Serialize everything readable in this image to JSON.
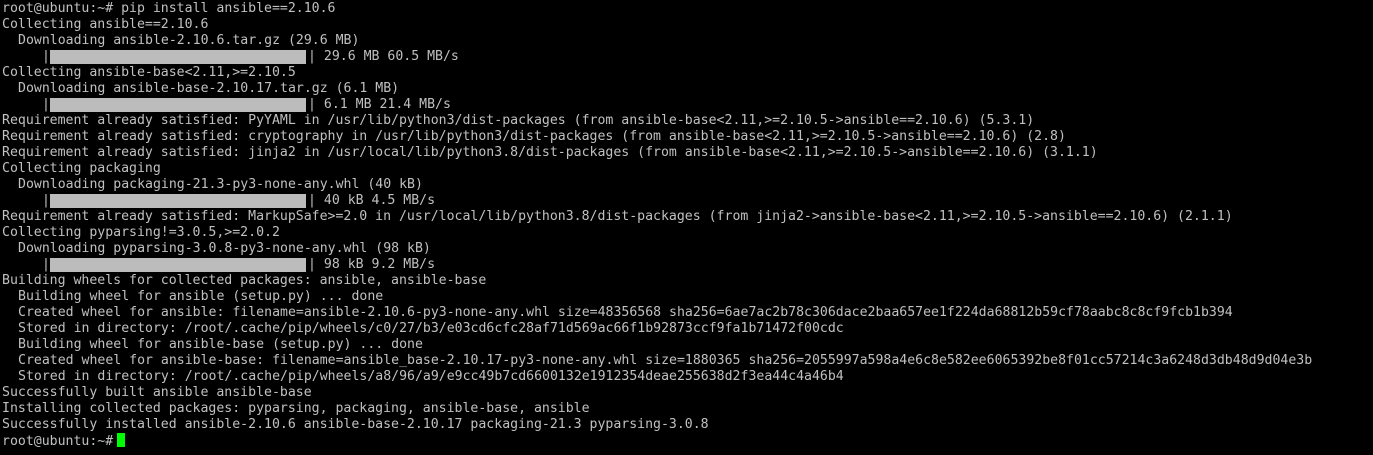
{
  "terminal": {
    "prompt": "root@ubuntu:~#",
    "command": "pip install ansible==2.10.6",
    "lines": [
      {
        "type": "text",
        "indent": 0,
        "text": "Collecting ansible==2.10.6"
      },
      {
        "type": "text",
        "indent": 2,
        "text": "Downloading ansible-2.10.6.tar.gz (29.6 MB)"
      },
      {
        "type": "bar",
        "progress": 1.0,
        "text": "| 29.6 MB 60.5 MB/s"
      },
      {
        "type": "text",
        "indent": 0,
        "text": "Collecting ansible-base<2.11,>=2.10.5"
      },
      {
        "type": "text",
        "indent": 2,
        "text": "Downloading ansible-base-2.10.17.tar.gz (6.1 MB)"
      },
      {
        "type": "bar",
        "progress": 1.0,
        "text": "| 6.1 MB 21.4 MB/s"
      },
      {
        "type": "text",
        "indent": 0,
        "text": "Requirement already satisfied: PyYAML in /usr/lib/python3/dist-packages (from ansible-base<2.11,>=2.10.5->ansible==2.10.6) (5.3.1)"
      },
      {
        "type": "text",
        "indent": 0,
        "text": "Requirement already satisfied: cryptography in /usr/lib/python3/dist-packages (from ansible-base<2.11,>=2.10.5->ansible==2.10.6) (2.8)"
      },
      {
        "type": "text",
        "indent": 0,
        "text": "Requirement already satisfied: jinja2 in /usr/local/lib/python3.8/dist-packages (from ansible-base<2.11,>=2.10.5->ansible==2.10.6) (3.1.1)"
      },
      {
        "type": "text",
        "indent": 0,
        "text": "Collecting packaging"
      },
      {
        "type": "text",
        "indent": 2,
        "text": "Downloading packaging-21.3-py3-none-any.whl (40 kB)"
      },
      {
        "type": "bar",
        "progress": 1.0,
        "text": "| 40 kB 4.5 MB/s"
      },
      {
        "type": "text",
        "indent": 0,
        "text": "Requirement already satisfied: MarkupSafe>=2.0 in /usr/local/lib/python3.8/dist-packages (from jinja2->ansible-base<2.11,>=2.10.5->ansible==2.10.6) (2.1.1)"
      },
      {
        "type": "text",
        "indent": 0,
        "text": "Collecting pyparsing!=3.0.5,>=2.0.2"
      },
      {
        "type": "text",
        "indent": 2,
        "text": "Downloading pyparsing-3.0.8-py3-none-any.whl (98 kB)"
      },
      {
        "type": "bar",
        "progress": 1.0,
        "text": "| 98 kB 9.2 MB/s"
      },
      {
        "type": "text",
        "indent": 0,
        "text": "Building wheels for collected packages: ansible, ansible-base"
      },
      {
        "type": "text",
        "indent": 2,
        "text": "Building wheel for ansible (setup.py) ... done"
      },
      {
        "type": "text",
        "indent": 2,
        "text": "Created wheel for ansible: filename=ansible-2.10.6-py3-none-any.whl size=48356568 sha256=6ae7ac2b78c306dace2baa657ee1f224da68812b59cf78aabc8c8cf9fcb1b394"
      },
      {
        "type": "text",
        "indent": 2,
        "text": "Stored in directory: /root/.cache/pip/wheels/c0/27/b3/e03cd6cfc28af71d569ac66f1b92873ccf9fa1b71472f00cdc"
      },
      {
        "type": "text",
        "indent": 2,
        "text": "Building wheel for ansible-base (setup.py) ... done"
      },
      {
        "type": "text",
        "indent": 2,
        "text": "Created wheel for ansible-base: filename=ansible_base-2.10.17-py3-none-any.whl size=1880365 sha256=2055997a598a4e6c8e582ee6065392be8f01cc57214c3a6248d3db48d9d04e3b"
      },
      {
        "type": "text",
        "indent": 2,
        "text": "Stored in directory: /root/.cache/pip/wheels/a8/96/a9/e9cc49b7cd6600132e1912354deae255638d2f3ea44c4a46b4"
      },
      {
        "type": "text",
        "indent": 0,
        "text": "Successfully built ansible ansible-base"
      },
      {
        "type": "text",
        "indent": 0,
        "text": "Installing collected packages: pyparsing, packaging, ansible-base, ansible"
      },
      {
        "type": "text",
        "indent": 0,
        "text": "Successfully installed ansible-2.10.6 ansible-base-2.10.17 packaging-21.3 pyparsing-3.0.8"
      }
    ],
    "final_prompt": "root@ubuntu:~#",
    "colors": {
      "background": "#000000",
      "foreground": "#c0c0c0",
      "progress_fill": "#bcbcbc",
      "cursor": "#00ff00"
    }
  }
}
